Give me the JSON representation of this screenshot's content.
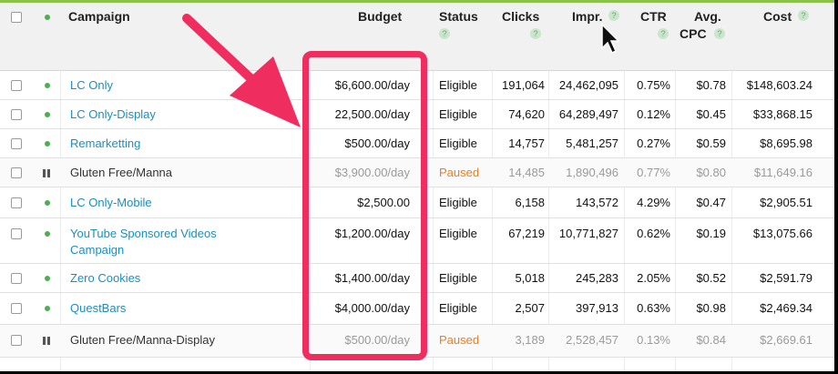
{
  "headers": {
    "campaign": "Campaign",
    "budget": "Budget",
    "status": "Status",
    "clicks": "Clicks",
    "impr": "Impr.",
    "ctr": "CTR",
    "avg_cpc": "Avg.",
    "avg_cpc_2": "CPC",
    "cost": "Cost",
    "help_icon": "?"
  },
  "rows": [
    {
      "name": "LC Only",
      "budget": "$6,600.00/day",
      "status": "Eligible",
      "clicks": "191,064",
      "impr": "24,462,095",
      "ctr": "0.75%",
      "cpc": "$0.78",
      "cost": "$148,603.24"
    },
    {
      "name": "LC Only-Display",
      "budget": "22,500.00/day",
      "status": "Eligible",
      "clicks": "74,620",
      "impr": "64,289,497",
      "ctr": "0.12%",
      "cpc": "$0.45",
      "cost": "$33,868.15"
    },
    {
      "name": "Remarketting",
      "budget": "$500.00/day",
      "status": "Eligible",
      "clicks": "14,757",
      "impr": "5,481,257",
      "ctr": "0.27%",
      "cpc": "$0.59",
      "cost": "$8,695.98"
    },
    {
      "name": "Gluten Free/Manna",
      "budget": "$3,900.00/day",
      "status": "Paused",
      "clicks": "14,485",
      "impr": "1,890,496",
      "ctr": "0.77%",
      "cpc": "$0.80",
      "cost": "$11,649.16"
    },
    {
      "name": "LC Only-Mobile",
      "budget": "$2,500.00",
      "status": "Eligible",
      "clicks": "6,158",
      "impr": "143,572",
      "ctr": "4.29%",
      "cpc": "$0.47",
      "cost": "$2,905.51"
    },
    {
      "name": "YouTube Sponsored Videos",
      "name2": "Campaign",
      "budget": "$1,200.00/day",
      "status": "Eligible",
      "clicks": "67,219",
      "impr": "10,771,827",
      "ctr": "0.62%",
      "cpc": "$0.19",
      "cost": "$13,075.66"
    },
    {
      "name": "Zero Cookies",
      "budget": "$1,400.00/day",
      "status": "Eligible",
      "clicks": "5,018",
      "impr": "245,283",
      "ctr": "2.05%",
      "cpc": "$0.52",
      "cost": "$2,591.79"
    },
    {
      "name": "QuestBars",
      "budget": "$4,000.00/day",
      "status": "Eligible",
      "clicks": "2,507",
      "impr": "397,913",
      "ctr": "0.63%",
      "cpc": "$0.98",
      "cost": "$2,469.34"
    },
    {
      "name": "Gluten Free/Manna-Display",
      "budget": "$500.00/day",
      "status": "Paused",
      "clicks": "3,189",
      "impr": "2,528,457",
      "ctr": "0.13%",
      "cpc": "$0.84",
      "cost": "$2,669.61"
    }
  ],
  "colors": {
    "highlight": "#f02d5f",
    "link": "#1a8fbf",
    "paused": "#e67e22",
    "enabled_dot": "#4caf50"
  }
}
